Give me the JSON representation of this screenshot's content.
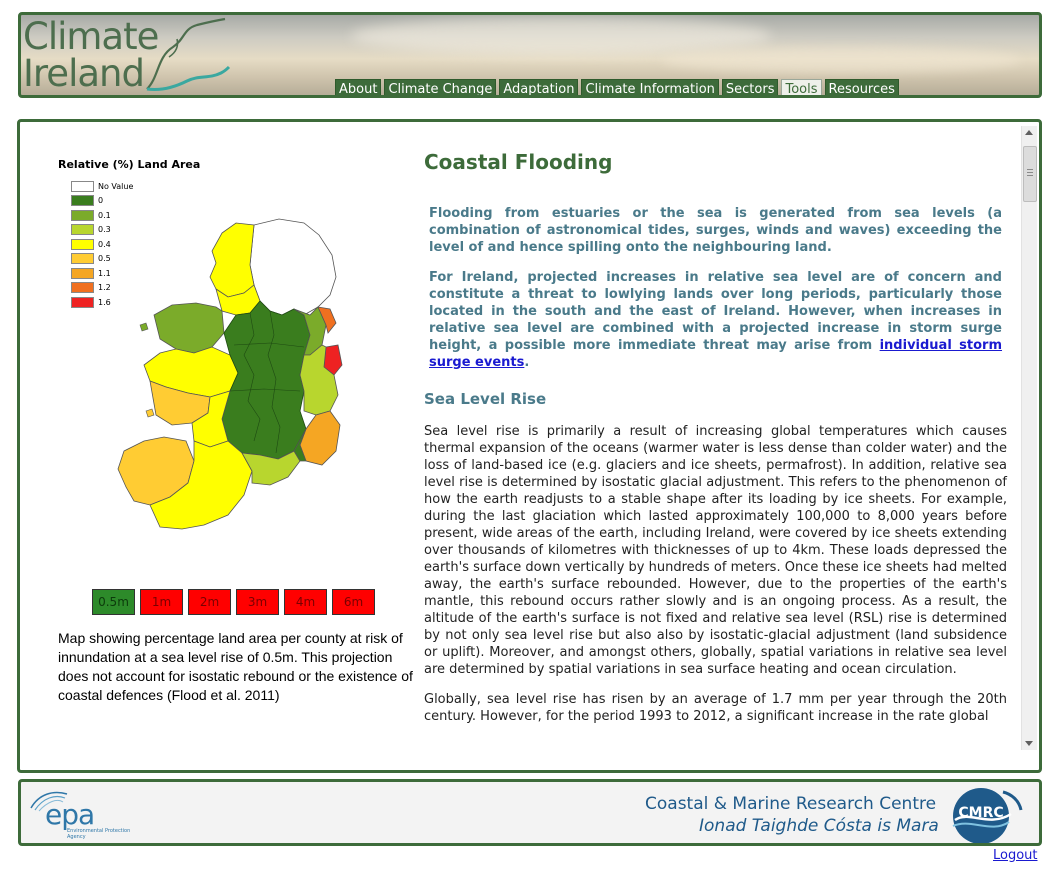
{
  "site": {
    "logo_line1": "Climate",
    "logo_line2": "Ireland"
  },
  "nav": {
    "tabs": [
      {
        "label": "About"
      },
      {
        "label": "Climate Change"
      },
      {
        "label": "Adaptation"
      },
      {
        "label": "Climate Information"
      },
      {
        "label": "Sectors"
      },
      {
        "label": "Tools",
        "active": true
      },
      {
        "label": "Resources"
      }
    ]
  },
  "map": {
    "title": "Relative (%) Land Area",
    "legend": [
      {
        "label": "No Value",
        "color": "#ffffff"
      },
      {
        "label": "0",
        "color": "#3a7d1e"
      },
      {
        "label": "0.1",
        "color": "#7bab2a"
      },
      {
        "label": "0.3",
        "color": "#b8d62e"
      },
      {
        "label": "0.4",
        "color": "#ffff00"
      },
      {
        "label": "0.5",
        "color": "#ffcc33"
      },
      {
        "label": "1.1",
        "color": "#f5a623"
      },
      {
        "label": "1.2",
        "color": "#f07020"
      },
      {
        "label": "1.6",
        "color": "#ee2222"
      }
    ],
    "slr_buttons": [
      {
        "label": "0.5m",
        "active": true
      },
      {
        "label": "1m"
      },
      {
        "label": "2m"
      },
      {
        "label": "3m"
      },
      {
        "label": "4m"
      },
      {
        "label": "6m"
      }
    ],
    "caption": "Map showing percentage land area per county at risk of innundation at a sea level rise of 0.5m.  This projection does not account for isostatic rebound or the existence of coastal defences (Flood et al. 2011)"
  },
  "article": {
    "title": "Coastal Flooding",
    "intro_p1": "Flooding from estuaries or the sea is generated from sea levels (a combination of astronomical tides, surges, winds and waves) exceeding the level of and hence spilling onto the neighbouring land.",
    "intro_p2": "For Ireland, projected increases in relative sea level are of concern and constitute a threat to lowlying lands over long periods, particularly those located in the south and the east of Ireland. However, when increases in relative sea level are combined with a projected increase in storm surge height, a possible more immediate threat may arise from ",
    "intro_link": "individual storm surge events",
    "intro_end": ".",
    "section_title": "Sea Level Rise",
    "body_p1": "Sea level rise is primarily a result of increasing global temperatures which causes thermal expansion of the oceans (warmer water is less dense than colder water) and the loss of land-based ice (e.g. glaciers and ice sheets, permafrost). In addition, relative sea level rise is determined by isostatic glacial adjustment. This refers to the phenomenon of how the earth readjusts to a stable shape after its loading by ice sheets. For example, during the last glaciation which lasted approximately 100,000 to 8,000 years before present, wide areas of the earth, including Ireland, were covered by ice sheets extending over thousands of kilometres with thicknesses of up to 4km. These loads depressed the earth's surface down vertically by hundreds of meters. Once these ice sheets had melted away, the earth's surface rebounded. However, due to the properties of the earth's mantle, this rebound occurs rather slowly and is an ongoing process. As a result, the altitude of the earth's surface is not fixed and relative sea level (RSL) rise is determined by not only sea level rise but also also by isostatic-glacial adjustment (land subsidence or uplift). Moreover, and amongst others, globally, spatial variations in relative sea level are determined by spatial variations in sea surface heating and ocean circulation.",
    "body_p2": "Globally, sea level rise has risen by an average of 1.7 mm per year through the 20th century. However, for the period 1993 to 2012, a significant increase in the rate global"
  },
  "footer": {
    "epa_word": "epa",
    "epa_small": "Environmental Protection Agency",
    "cmrc_en": "Coastal & Marine Research Centre",
    "cmrc_ga": "Ionad Taighde Cósta is Mara",
    "cmrc_badge": "CMRC"
  },
  "logout": "Logout"
}
